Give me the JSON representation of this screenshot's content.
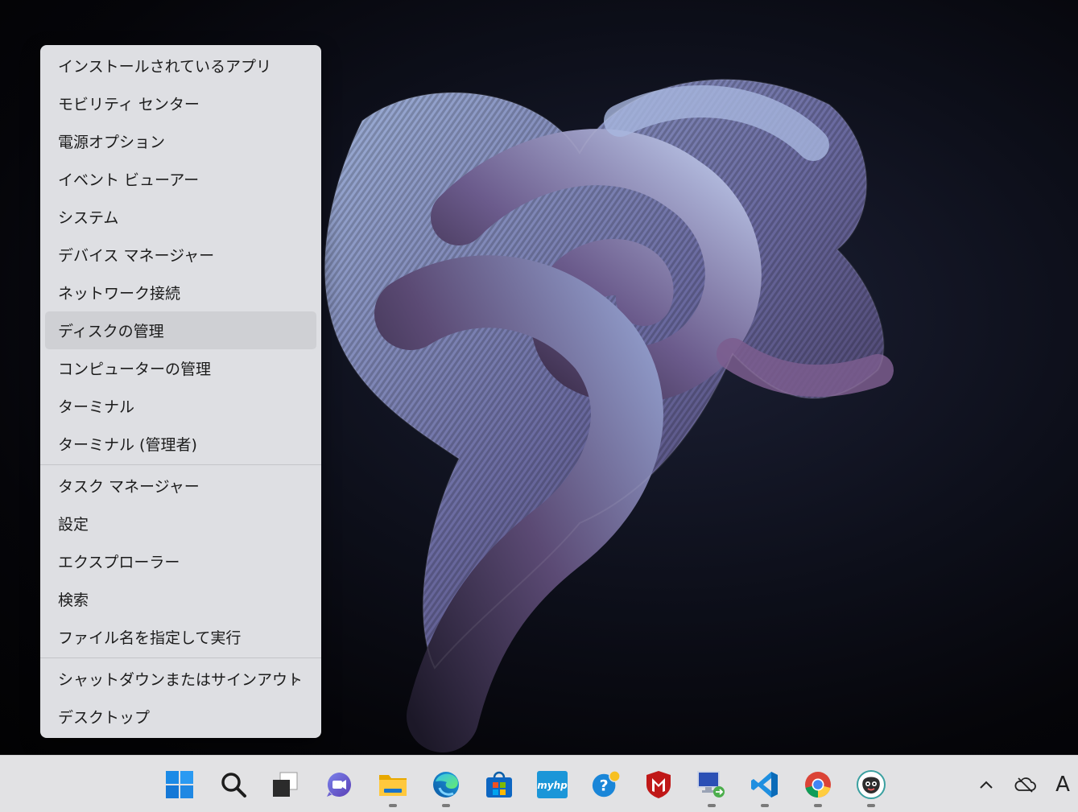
{
  "menu": {
    "items": [
      {
        "label": "インストールされているアプリ"
      },
      {
        "label": "モビリティ センター"
      },
      {
        "label": "電源オプション"
      },
      {
        "label": "イベント ビューアー"
      },
      {
        "label": "システム"
      },
      {
        "label": "デバイス マネージャー"
      },
      {
        "label": "ネットワーク接続"
      },
      {
        "label": "ディスクの管理"
      },
      {
        "label": "コンピューターの管理"
      },
      {
        "label": "ターミナル"
      },
      {
        "label": "ターミナル (管理者)"
      }
    ],
    "items2": [
      {
        "label": "タスク マネージャー"
      },
      {
        "label": "設定"
      },
      {
        "label": "エクスプローラー"
      },
      {
        "label": "検索"
      },
      {
        "label": "ファイル名を指定して実行"
      }
    ],
    "items3": [
      {
        "label": "シャットダウンまたはサインアウト",
        "submenu_chevron": "›"
      },
      {
        "label": "デスクトップ"
      }
    ],
    "hovered_item": "ディスクの管理"
  },
  "taskbar": {
    "icons": [
      {
        "name": "start-icon",
        "running": false
      },
      {
        "name": "search-icon",
        "running": false
      },
      {
        "name": "task-view-icon",
        "running": false
      },
      {
        "name": "teams-chat-icon",
        "running": false
      },
      {
        "name": "file-explorer-icon",
        "running": true
      },
      {
        "name": "edge-icon",
        "running": true
      },
      {
        "name": "microsoft-store-icon",
        "running": false
      },
      {
        "name": "myhp-icon",
        "label": "myhp",
        "running": false
      },
      {
        "name": "get-help-icon",
        "running": false
      },
      {
        "name": "mcafee-icon",
        "running": false
      },
      {
        "name": "remote-desktop-icon",
        "running": true
      },
      {
        "name": "vscode-icon",
        "running": true
      },
      {
        "name": "chrome-icon",
        "running": true
      },
      {
        "name": "app-mascot-icon",
        "running": true
      }
    ],
    "tray": {
      "chevron": "^",
      "ime_label": "A"
    }
  },
  "colors": {
    "menu_bg": "#dedfe3",
    "menu_hover": "#cfd0d4",
    "taskbar_bg": "#e2e2e4",
    "accent_blue": "#0a74d9"
  }
}
